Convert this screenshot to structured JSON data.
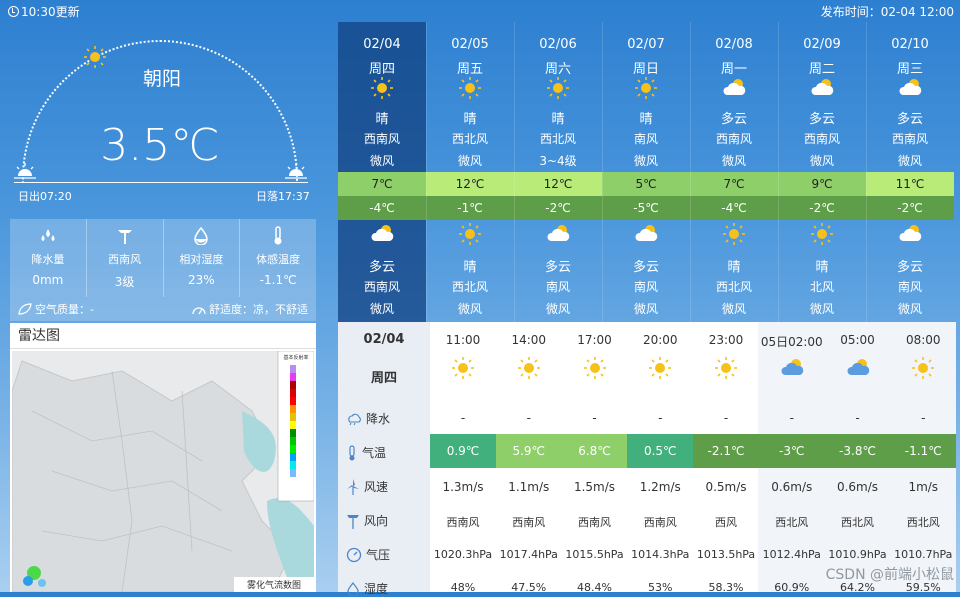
{
  "header": {
    "update_time": "10:30更新",
    "publish": "发布时间：02-04 12:00"
  },
  "current": {
    "city": "朝阳",
    "temp": "3.5℃",
    "sunrise": "日出07:20",
    "sunset": "日落17:37"
  },
  "stats": [
    {
      "icon": "rain-drops-icon",
      "label": "降水量",
      "value": "0mm"
    },
    {
      "icon": "wind-vane-icon",
      "label": "西南风",
      "value": "3级"
    },
    {
      "icon": "humidity-icon",
      "label": "相对湿度",
      "value": "23%"
    },
    {
      "icon": "thermometer-icon",
      "label": "体感温度",
      "value": "-1.1℃"
    }
  ],
  "air": {
    "quality": "空气质量：-",
    "comfort": "舒适度：凉，不舒适"
  },
  "radar": {
    "title": "雷达图",
    "legend_title": "基本反射率",
    "caption": "雾化气流数图"
  },
  "days": [
    {
      "date": "02/04",
      "week": "周四",
      "day_icon": "sun",
      "day_cond": "晴",
      "day_wind": "西南风",
      "day_ws": "微风",
      "hi": "7℃",
      "lo": "-4℃",
      "night_icon": "cloud",
      "night_cond": "多云",
      "night_wind": "西南风",
      "night_ws": "微风"
    },
    {
      "date": "02/05",
      "week": "周五",
      "day_icon": "sun",
      "day_cond": "晴",
      "day_wind": "西北风",
      "day_ws": "微风",
      "hi": "12℃",
      "lo": "-1℃",
      "night_icon": "sun",
      "night_cond": "晴",
      "night_wind": "西北风",
      "night_ws": "微风"
    },
    {
      "date": "02/06",
      "week": "周六",
      "day_icon": "sun",
      "day_cond": "晴",
      "day_wind": "西北风",
      "day_ws": "3~4级",
      "hi": "12℃",
      "lo": "-2℃",
      "night_icon": "cloud",
      "night_cond": "多云",
      "night_wind": "南风",
      "night_ws": "微风"
    },
    {
      "date": "02/07",
      "week": "周日",
      "day_icon": "sun",
      "day_cond": "晴",
      "day_wind": "南风",
      "day_ws": "微风",
      "hi": "5℃",
      "lo": "-5℃",
      "night_icon": "cloud",
      "night_cond": "多云",
      "night_wind": "南风",
      "night_ws": "微风"
    },
    {
      "date": "02/08",
      "week": "周一",
      "day_icon": "cloud",
      "day_cond": "多云",
      "day_wind": "西南风",
      "day_ws": "微风",
      "hi": "7℃",
      "lo": "-4℃",
      "night_icon": "sun",
      "night_cond": "晴",
      "night_wind": "西北风",
      "night_ws": "微风"
    },
    {
      "date": "02/09",
      "week": "周二",
      "day_icon": "cloud",
      "day_cond": "多云",
      "day_wind": "西南风",
      "day_ws": "微风",
      "hi": "9℃",
      "lo": "-2℃",
      "night_icon": "sun",
      "night_cond": "晴",
      "night_wind": "北风",
      "night_ws": "微风"
    },
    {
      "date": "02/10",
      "week": "周三",
      "day_icon": "cloud",
      "day_cond": "多云",
      "day_wind": "西南风",
      "day_ws": "微风",
      "hi": "11℃",
      "lo": "-2℃",
      "night_icon": "cloud",
      "night_cond": "多云",
      "night_wind": "南风",
      "night_ws": "微风"
    }
  ],
  "hourly": {
    "date": "02/04",
    "week": "周四",
    "labels": {
      "rain": "降水",
      "temp": "气温",
      "wind_speed": "风速",
      "wind_dir": "风向",
      "pressure": "气压",
      "humidity": "湿度"
    },
    "hours": [
      {
        "time": "11:00",
        "icon": "sun",
        "rain": "-",
        "temp": "0.9℃",
        "ws": "1.3m/s",
        "wd": "西南风",
        "p": "1020.3hPa",
        "h": "48%"
      },
      {
        "time": "14:00",
        "icon": "sun",
        "rain": "-",
        "temp": "5.9℃",
        "ws": "1.1m/s",
        "wd": "西南风",
        "p": "1017.4hPa",
        "h": "47.5%"
      },
      {
        "time": "17:00",
        "icon": "sun",
        "rain": "-",
        "temp": "6.8℃",
        "ws": "1.5m/s",
        "wd": "西南风",
        "p": "1015.5hPa",
        "h": "48.4%"
      },
      {
        "time": "20:00",
        "icon": "sun",
        "rain": "-",
        "temp": "0.5℃",
        "ws": "1.2m/s",
        "wd": "西南风",
        "p": "1014.3hPa",
        "h": "53%"
      },
      {
        "time": "23:00",
        "icon": "sun",
        "rain": "-",
        "temp": "-2.1℃",
        "ws": "0.5m/s",
        "wd": "西风",
        "p": "1013.5hPa",
        "h": "58.3%"
      },
      {
        "time": "05日02:00",
        "icon": "cloud",
        "rain": "-",
        "temp": "-3℃",
        "ws": "0.6m/s",
        "wd": "西北风",
        "p": "1012.4hPa",
        "h": "60.9%"
      },
      {
        "time": "05:00",
        "icon": "cloud",
        "rain": "-",
        "temp": "-3.8℃",
        "ws": "0.6m/s",
        "wd": "西北风",
        "p": "1010.9hPa",
        "h": "64.2%"
      },
      {
        "time": "08:00",
        "icon": "sun",
        "rain": "-",
        "temp": "-1.1℃",
        "ws": "1m/s",
        "wd": "西北风",
        "p": "1010.7hPa",
        "h": "59.5%"
      }
    ]
  },
  "colors": {
    "hi_band": [
      "#8fcf6a",
      "#b8eb78",
      "#b8eb78",
      "#8fcf6a",
      "#8fcf6a",
      "#8fcf6a",
      "#b8eb78"
    ],
    "lo_band": "#5e9e48",
    "temp_cells": [
      "#41b07c",
      "#8fcf6a",
      "#8fcf6a",
      "#41b07c",
      "#5e9e48",
      "#5e9e48",
      "#5e9e48",
      "#5e9e48"
    ]
  },
  "watermark": "CSDN @前端小松鼠"
}
